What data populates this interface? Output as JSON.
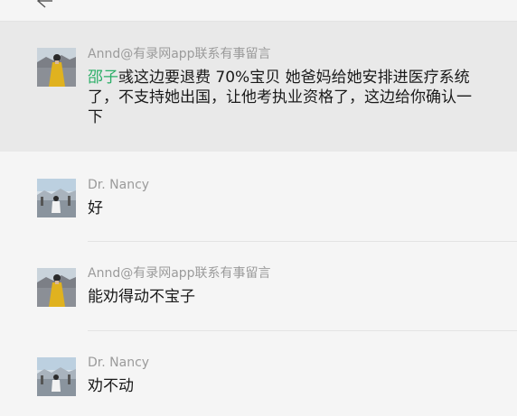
{
  "header": {
    "back_icon": "back-arrow-icon"
  },
  "messages": [
    {
      "sender": "Annd@有录网app联系有事留言",
      "mention": "邵子",
      "text": "彧这边要退费 70%宝贝 她爸妈给她安排进医疗系统了，不支持她出国，让他考执业资格了，这边给你确认一下",
      "avatar": "avatar-woman-yellow-dress"
    },
    {
      "sender": "Dr. Nancy",
      "text": "好",
      "avatar": "avatar-landscape-person"
    },
    {
      "sender": "Annd@有录网app联系有事留言",
      "text": "能劝得动不宝子",
      "avatar": "avatar-woman-yellow-dress"
    },
    {
      "sender": "Dr. Nancy",
      "text": "劝不动",
      "avatar": "avatar-landscape-person"
    }
  ],
  "colors": {
    "background": "#f5f5f5",
    "highlight": "#e9e9e9",
    "mention": "#2aae67",
    "sender": "#9b9b9b",
    "text": "#1a1a1a"
  }
}
